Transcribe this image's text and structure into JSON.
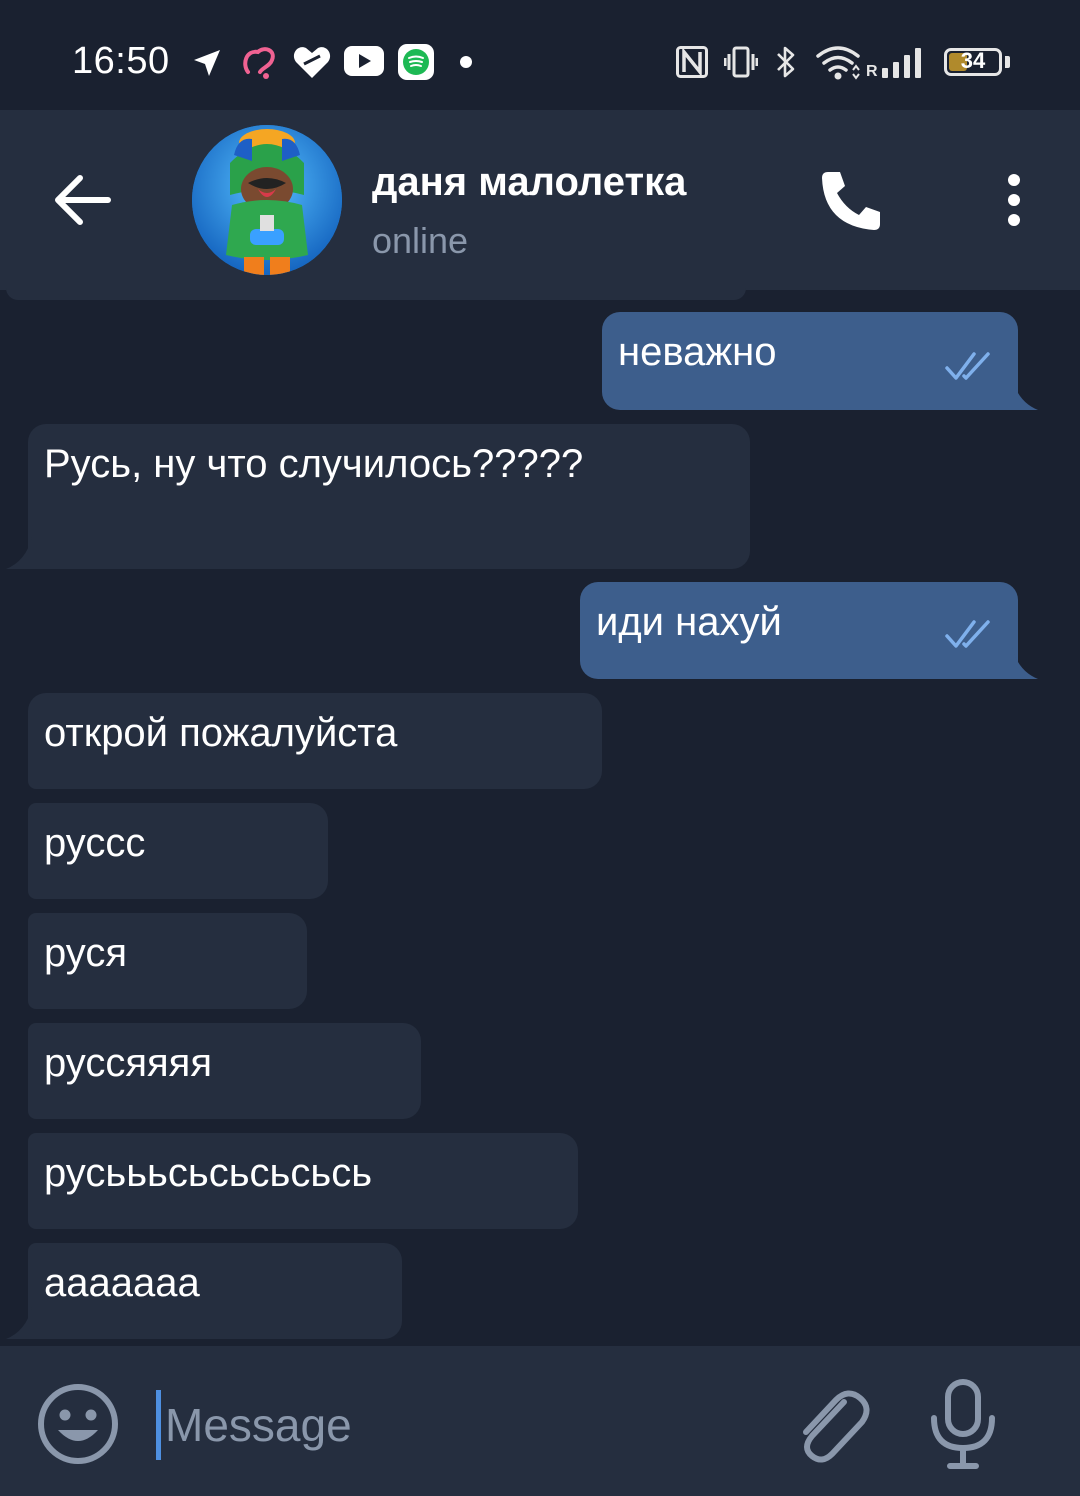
{
  "status_bar": {
    "time": "16:50",
    "battery_percent": "34"
  },
  "header": {
    "contact_name": "даня малолетка",
    "status": "online"
  },
  "messages": [
    {
      "direction": "outgoing",
      "text": "неважно",
      "read": true
    },
    {
      "direction": "incoming",
      "text": "Русь, ну что случилось?????"
    },
    {
      "direction": "outgoing",
      "text": "иди нахуй",
      "read": true
    },
    {
      "direction": "incoming",
      "text": "открой пожалуйста"
    },
    {
      "direction": "incoming",
      "text": "русcc"
    },
    {
      "direction": "incoming",
      "text": "руся"
    },
    {
      "direction": "incoming",
      "text": "руссяяяя"
    },
    {
      "direction": "incoming",
      "text": "русьььсьсьсьсьсь"
    },
    {
      "direction": "incoming",
      "text": "ааааааа"
    }
  ],
  "composer": {
    "placeholder": "Message"
  },
  "icons": {
    "back": "arrow-left-icon",
    "call": "phone-icon",
    "menu": "more-vertical-icon",
    "emoji": "smiley-icon",
    "attach": "paperclip-icon",
    "mic": "microphone-icon",
    "read_receipt": "double-check-icon"
  },
  "colors": {
    "background": "#1a2130",
    "panel": "#252e3f",
    "incoming_bubble": "#252e3f",
    "outgoing_bubble": "#3d5e8c",
    "secondary_text": "#8a97ab",
    "check_color": "#7fb0ec"
  }
}
